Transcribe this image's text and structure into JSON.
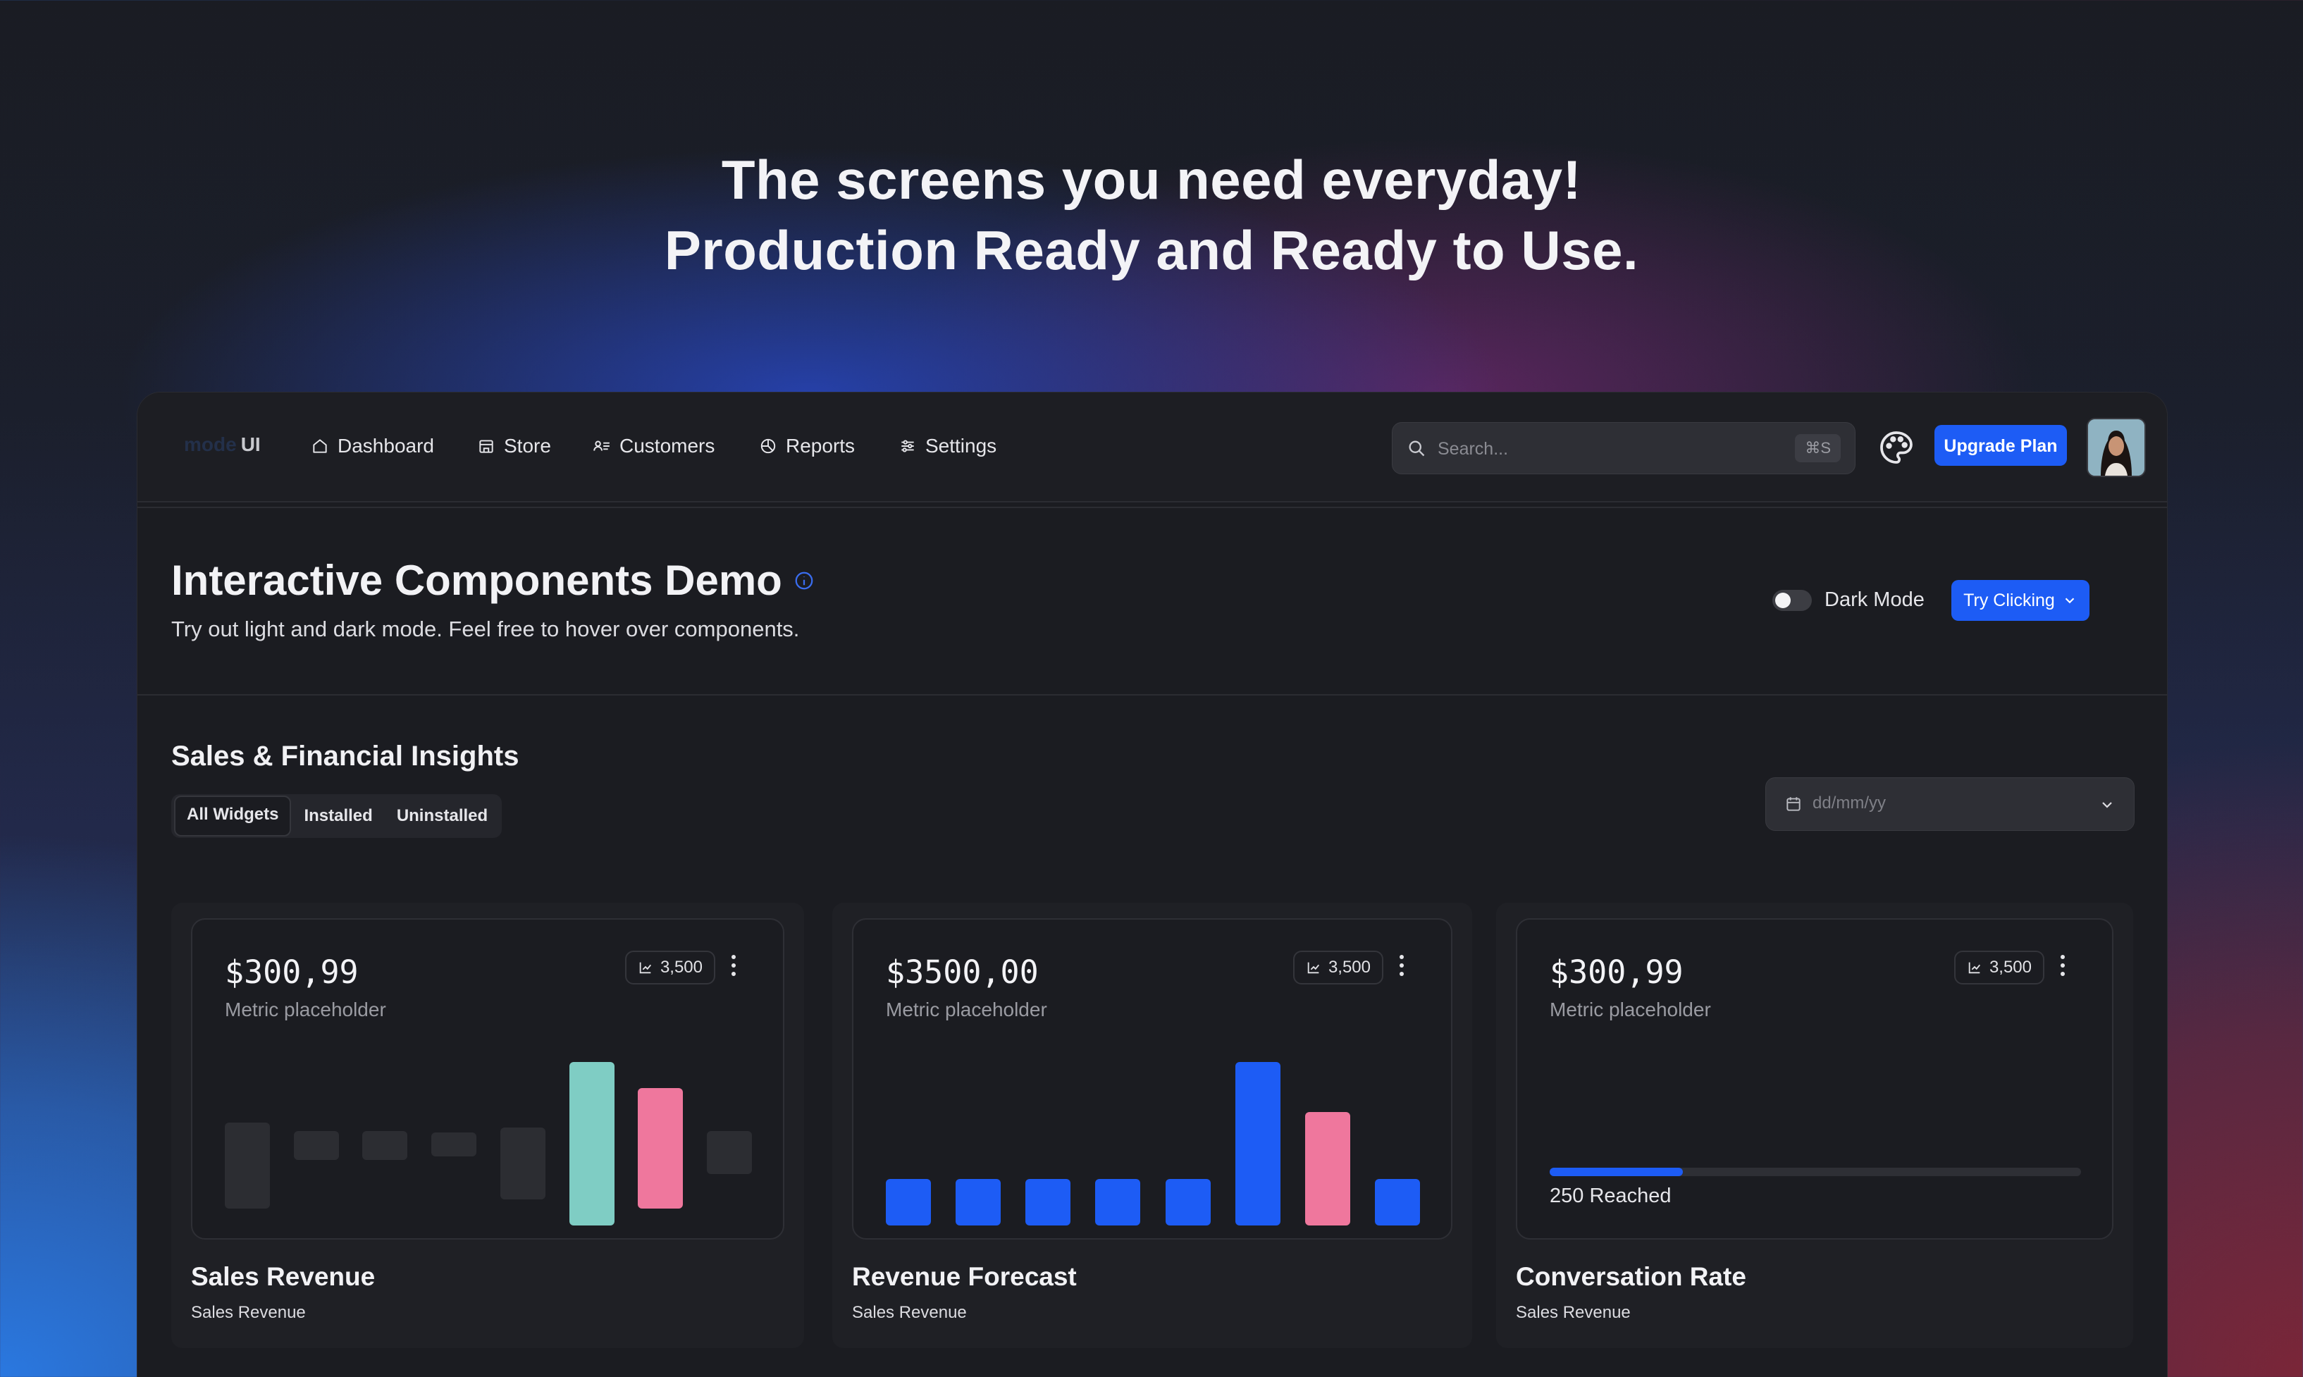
{
  "hero": {
    "line1": "The screens you need everyday!",
    "line2": "Production Ready and Ready to Use."
  },
  "nav": {
    "logo_dim": "mode",
    "logo_ui": "UI",
    "items": [
      {
        "label": "Dashboard",
        "icon": "home-icon"
      },
      {
        "label": "Store",
        "icon": "store-icon"
      },
      {
        "label": "Customers",
        "icon": "customers-icon"
      },
      {
        "label": "Reports",
        "icon": "pie-chart-icon"
      },
      {
        "label": "Settings",
        "icon": "sliders-icon"
      }
    ],
    "search_placeholder": "Search...",
    "search_shortcut": "⌘S",
    "upgrade_label": "Upgrade Plan"
  },
  "header": {
    "title": "Interactive Components Demo",
    "subtitle": "Try out light and dark mode. Feel free to hover over components.",
    "toggle_label": "Dark Mode",
    "dark_mode_on": false,
    "try_label": "Try Clicking"
  },
  "section": {
    "title": "Sales & Financial Insights",
    "tabs": [
      "All Widgets",
      "Installed",
      "Uninstalled"
    ],
    "active_tab": "All Widgets",
    "date_placeholder": "dd/mm/yy"
  },
  "colors": {
    "accent": "#1d5cf5",
    "teal": "#7fcdc4",
    "pink": "#ef779d",
    "muted_bar": "#2c2d32"
  },
  "cards": [
    {
      "value": "$300,99",
      "metric_label": "Metric placeholder",
      "pill": "3,500",
      "title": "Sales Revenue",
      "subtitle": "Sales Revenue",
      "chart_type": "floating-bars",
      "bars": [
        {
          "low": 0.1,
          "high": 0.6,
          "color": "muted"
        },
        {
          "low": 0.38,
          "high": 0.55,
          "color": "muted"
        },
        {
          "low": 0.38,
          "high": 0.55,
          "color": "muted"
        },
        {
          "low": 0.4,
          "high": 0.54,
          "color": "muted"
        },
        {
          "low": 0.15,
          "high": 0.57,
          "color": "muted"
        },
        {
          "low": 0.0,
          "high": 0.95,
          "color": "teal"
        },
        {
          "low": 0.1,
          "high": 0.8,
          "color": "pink"
        },
        {
          "low": 0.3,
          "high": 0.55,
          "color": "muted"
        }
      ]
    },
    {
      "value": "$3500,00",
      "metric_label": "Metric placeholder",
      "pill": "3,500",
      "title": "Revenue Forecast",
      "subtitle": "Sales Revenue",
      "chart_type": "bars",
      "bars": [
        {
          "value": 0.27,
          "color": "accent"
        },
        {
          "value": 0.27,
          "color": "accent"
        },
        {
          "value": 0.27,
          "color": "accent"
        },
        {
          "value": 0.27,
          "color": "accent"
        },
        {
          "value": 0.27,
          "color": "accent"
        },
        {
          "value": 0.95,
          "color": "accent"
        },
        {
          "value": 0.66,
          "color": "pink"
        },
        {
          "value": 0.27,
          "color": "accent"
        }
      ]
    },
    {
      "value": "$300,99",
      "metric_label": "Metric placeholder",
      "pill": "3,500",
      "title": "Conversation Rate",
      "subtitle": "Sales Revenue",
      "chart_type": "progress",
      "progress": 0.25,
      "progress_label": "250 Reached"
    }
  ]
}
